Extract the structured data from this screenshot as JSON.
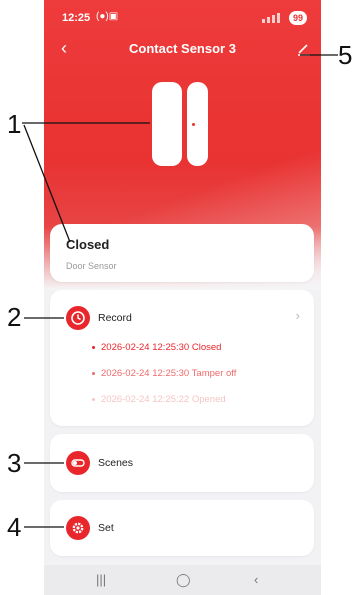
{
  "status_bar": {
    "time": "12:25",
    "notif_icons": "(●)▣",
    "battery": "99"
  },
  "header": {
    "title": "Contact Sensor 3"
  },
  "device_status": {
    "state": "Closed",
    "type": "Door Sensor"
  },
  "record": {
    "label": "Record",
    "entries": [
      "2026-02-24 12:25:30 Closed",
      "2026-02-24 12:25:30 Tamper off",
      "2026-02-24 12:25:22 Opened"
    ]
  },
  "scenes": {
    "label": "Scenes"
  },
  "settings": {
    "label": "Set"
  },
  "callouts": [
    "1",
    "2",
    "3",
    "4",
    "5"
  ],
  "colors": {
    "accent": "#e93232",
    "icon_red": "#e8262b",
    "background": "#f2f2f4"
  },
  "icons": {
    "back": "chevron-left-icon",
    "edit": "pencil-icon",
    "record": "clock-icon",
    "scenes": "toggle-icon",
    "set": "gear-icon"
  }
}
